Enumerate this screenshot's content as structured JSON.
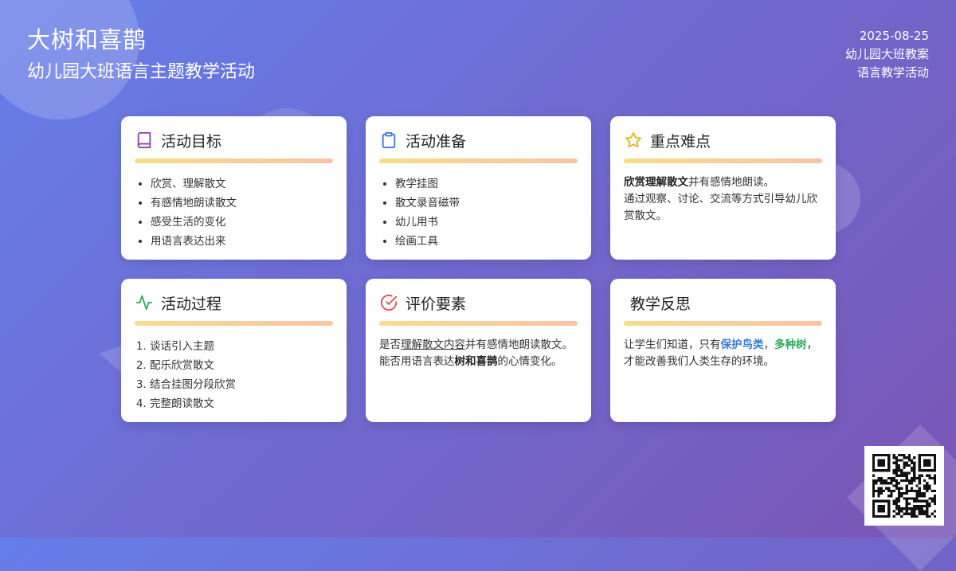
{
  "header": {
    "title": "大树和喜鹊",
    "subtitle": "幼儿园大班语言主题教学活动",
    "date": "2025-08-25",
    "meta1": "幼儿园大班教案",
    "meta2": "语言教学活动"
  },
  "colors": {
    "purple_icon": "#8e44ad",
    "blue_icon": "#3a7bd5",
    "yellow_icon": "#e8b617",
    "green_icon": "#2eaa5a",
    "red_icon": "#e05050"
  },
  "cards": {
    "goals": {
      "icon": "book-icon",
      "title": "活动目标",
      "items": [
        "欣赏、理解散文",
        "有感情地朗读散文",
        "感受生活的变化",
        "用语言表达出来"
      ]
    },
    "prep": {
      "icon": "clipboard-icon",
      "title": "活动准备",
      "items": [
        "教学挂图",
        "散文录音磁带",
        "幼儿用书",
        "绘画工具"
      ]
    },
    "key": {
      "icon": "star-icon",
      "title": "重点难点",
      "p1_strong": "欣赏理解散文",
      "p1_rest": "并有感情地朗读。",
      "p2": "通过观察、讨论、交流等方式引导幼儿欣赏散文。"
    },
    "process": {
      "icon": "activity-icon",
      "title": "活动过程",
      "items": [
        "谈话引入主题",
        "配乐欣赏散文",
        "结合挂图分段欣赏",
        "完整朗读散文"
      ]
    },
    "eval": {
      "icon": "check-circle-icon",
      "title": "评价要素",
      "p1_a": "是否",
      "p1_u": "理解散文内容",
      "p1_b": "并有感情地朗读散文。",
      "p2_a": "能否用语言表达",
      "p2_strong": "树和喜鹊",
      "p2_b": "的心情变化。"
    },
    "reflect": {
      "title": "教学反思",
      "p_a": "让学生们知道，只有",
      "p_blue": "保护鸟类",
      "p_sep": "，",
      "p_green": "多种树",
      "p_b": "，才能改善我们人类生存的环境。"
    }
  },
  "qr": {
    "icon": "qr-code-icon"
  }
}
